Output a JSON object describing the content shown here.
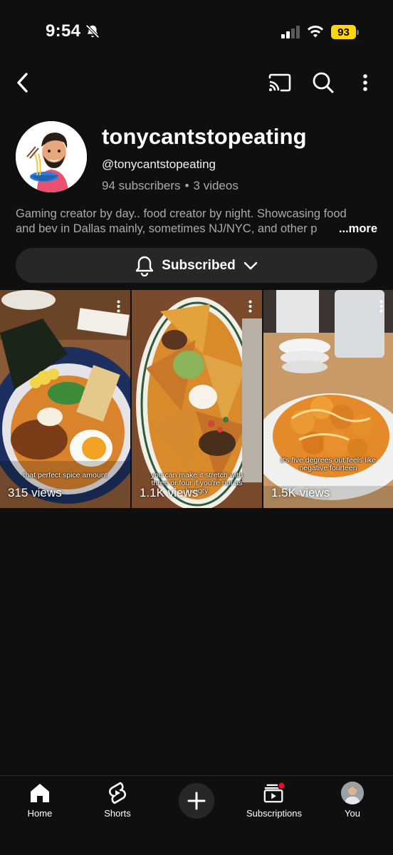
{
  "status_bar": {
    "time": "9:54",
    "battery": "93",
    "colors": {
      "battery": "#ffd60a"
    }
  },
  "top_bar": {
    "icons": [
      "back-icon",
      "cast-icon",
      "search-icon",
      "more-vert-icon"
    ]
  },
  "channel": {
    "name": "tonycantstopeating",
    "handle": "@tonycantstopeating",
    "subscribers": "94 subscribers",
    "separator": "•",
    "videos": "3 videos",
    "description_line1": "Gaming creator by day.. food creator by night. Showcasing food",
    "description_line2": "and bev in Dallas mainly, sometimes NJ/NYC, and other p",
    "more_label": "...more",
    "subscribe_label": "Subscribed"
  },
  "shorts": [
    {
      "views": "315 views",
      "caption": "that perfect spice amount"
    },
    {
      "views": "1.1K views",
      "caption": "you can make it stretch with three or four if you're not as hungry"
    },
    {
      "views": "1.5K views",
      "caption": "it's five degrees out feels like negative fourteen"
    }
  ],
  "bottom_nav": {
    "items": [
      {
        "label": "Home",
        "icon": "home-icon"
      },
      {
        "label": "Shorts",
        "icon": "shorts-icon"
      },
      {
        "label": "",
        "icon": "create-plus-icon"
      },
      {
        "label": "Subscriptions",
        "icon": "subscriptions-icon"
      },
      {
        "label": "You",
        "icon": "profile-avatar-icon"
      }
    ]
  },
  "colors": {
    "background": "#0f0f0f",
    "button": "#272727",
    "secondary_text": "#aaaaaa",
    "notification_dot": "#ff0033"
  }
}
